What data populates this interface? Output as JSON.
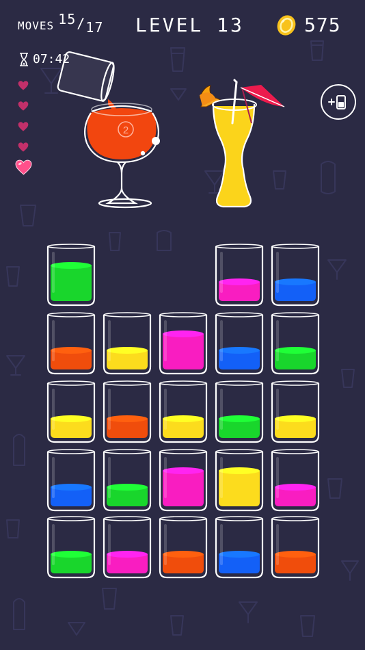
{
  "hud": {
    "moves_label": "MOVES",
    "moves_current": "15",
    "moves_separator": "/",
    "moves_total": "17",
    "level_title": "LEVEL 13",
    "coins": "575",
    "timer": "07:42"
  },
  "lives": {
    "total": 5,
    "remaining": 1
  },
  "pour_scene": {
    "snifter_badge": "2",
    "snifter_color": "#f2460f",
    "juice_color": "#fbd41b"
  },
  "buttons": {
    "add_tube_icon": "add-tube-icon"
  },
  "colors": {
    "green": "#19d62c",
    "pink": "#f91dc1",
    "blue": "#1360f7",
    "orange": "#f04d0c",
    "yellow": "#fcdc1d",
    "background": "#2b2a44",
    "heart_active": "#ff4f8b",
    "heart_inactive": "#c2306a",
    "coin": "#f8c21c"
  },
  "glasses": [
    [
      "green",
      4
    ],
    null,
    null,
    [
      "pink",
      2
    ],
    [
      "blue",
      2
    ],
    [
      "orange",
      2
    ],
    [
      "yellow",
      2
    ],
    [
      "pink",
      4
    ],
    [
      "blue",
      2
    ],
    [
      "green",
      2
    ],
    [
      "yellow",
      2
    ],
    [
      "orange",
      2
    ],
    [
      "yellow",
      2
    ],
    [
      "green",
      2
    ],
    [
      "yellow",
      2
    ],
    [
      "blue",
      2
    ],
    [
      "green",
      2
    ],
    [
      "pink",
      4
    ],
    [
      "yellow",
      4
    ],
    [
      "pink",
      2
    ],
    [
      "green",
      2
    ],
    [
      "pink",
      2
    ],
    [
      "orange",
      2
    ],
    [
      "blue",
      2
    ],
    [
      "orange",
      2
    ]
  ]
}
